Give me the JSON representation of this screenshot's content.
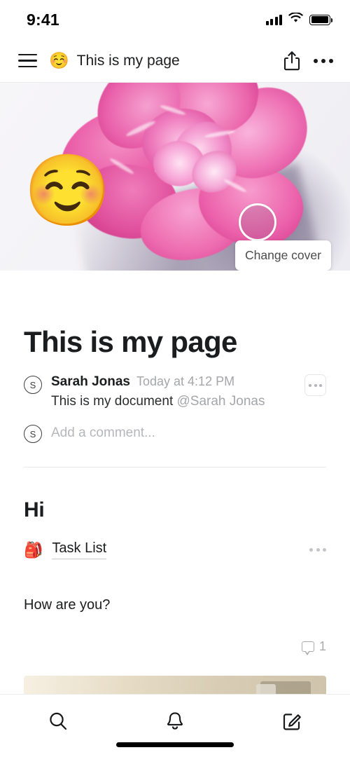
{
  "statusbar": {
    "time": "9:41",
    "signal_icon": "cellular-signal-icon",
    "wifi_icon": "wifi-icon",
    "battery_icon": "battery-full-icon"
  },
  "navbar": {
    "menu_icon": "hamburger-menu-icon",
    "page_emoji": "☺️",
    "title": "This is my page",
    "share_icon": "share-icon",
    "more_icon": "more-horizontal-icon"
  },
  "cover": {
    "description": "pink peony flower photo",
    "change_cover_label": "Change cover",
    "tap_indicator": "tap-indicator-circle",
    "page_emoji": "☺️",
    "accent_color": "#e95fa9",
    "background_color": "#f4f3f7"
  },
  "document": {
    "title": "This is my page",
    "comment": {
      "avatar_initial": "S",
      "author": "Sarah Jonas",
      "timestamp": "Today at 4:12 PM",
      "text": "This is my document ",
      "mention": "@Sarah Jonas",
      "more_icon": "more-horizontal-icon"
    },
    "add_comment": {
      "avatar_initial": "S",
      "placeholder": "Add a comment..."
    },
    "heading": "Hi",
    "task_list": {
      "emoji": "🎒",
      "label": "Task List",
      "more_icon": "more-horizontal-icon"
    },
    "paragraph": "How are you?",
    "comment_count": {
      "icon": "comment-bubble-icon",
      "count": "1"
    }
  },
  "tabbar": {
    "search_icon": "search-icon",
    "notifications_icon": "bell-icon",
    "compose_icon": "compose-icon"
  }
}
